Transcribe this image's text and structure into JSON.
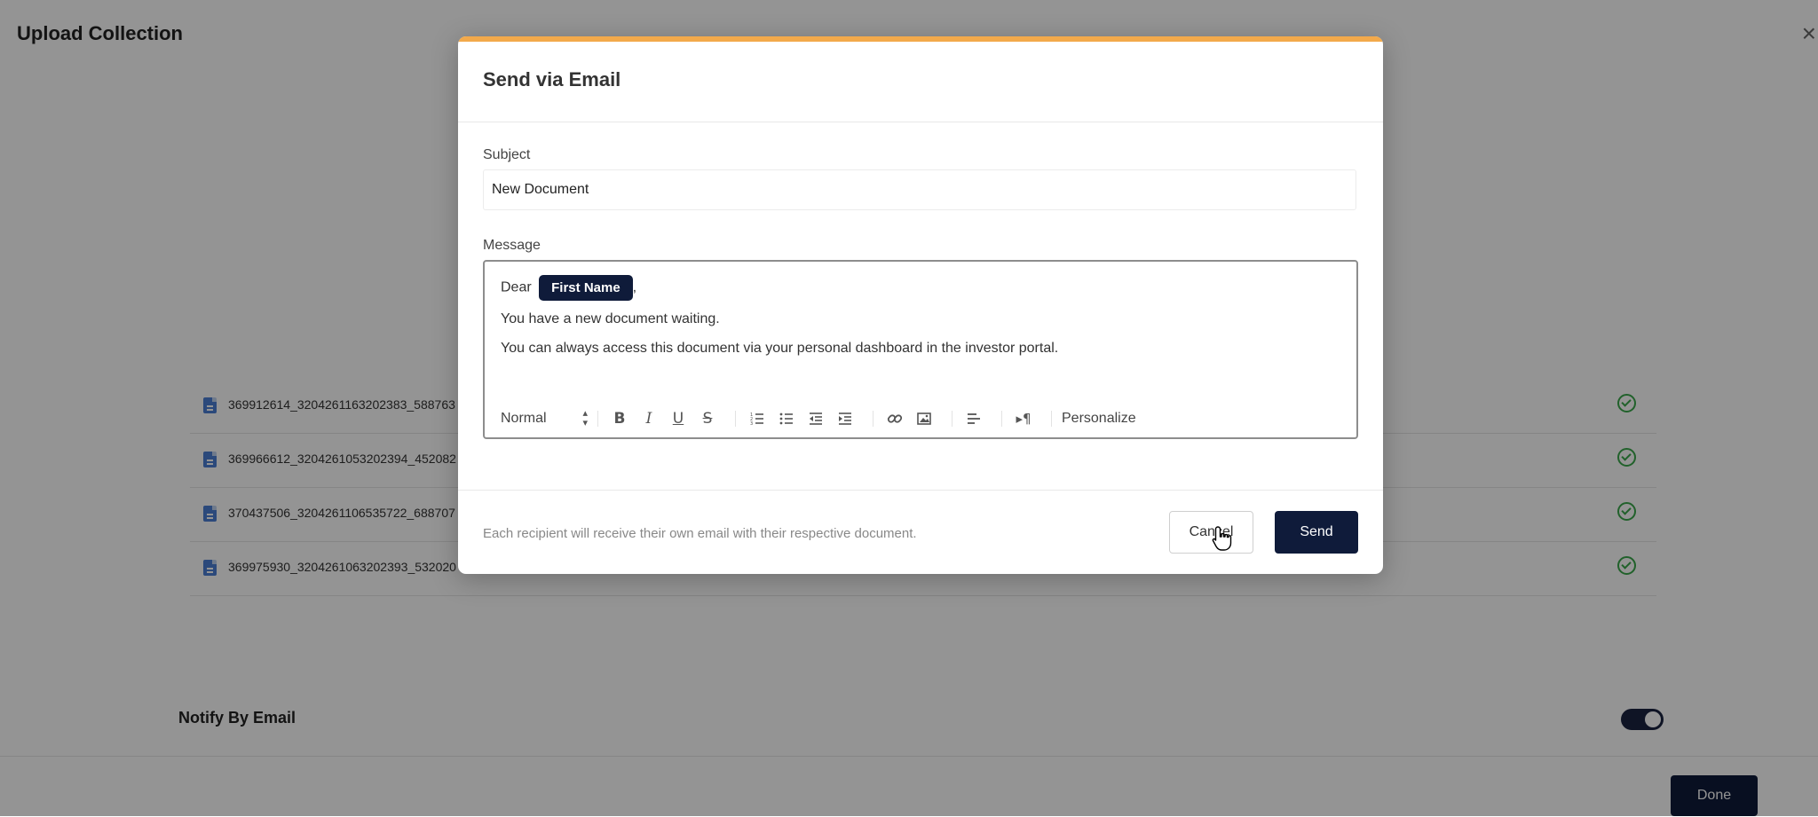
{
  "page": {
    "title": "Upload Collection",
    "close_icon": "close-icon",
    "files": [
      {
        "name": "369912614_3204261163202383_588763"
      },
      {
        "name": "369966612_3204261053202394_452082"
      },
      {
        "name": "370437506_3204261106535722_688707"
      },
      {
        "name": "369975930_3204261063202393_532020"
      }
    ],
    "notify_label": "Notify By Email",
    "notify_enabled": true,
    "done_label": "Done"
  },
  "modal": {
    "title": "Send via Email",
    "subject_label": "Subject",
    "subject_value": "New Document",
    "message_label": "Message",
    "message": {
      "greeting": "Dear",
      "tag": "First Name",
      "greeting_end": ",",
      "line1": "You have a new document waiting.",
      "line2": "You can always access this document via your personal dashboard in the investor portal."
    },
    "toolbar": {
      "format_select": "Normal",
      "buttons": [
        "bold-icon",
        "italic-icon",
        "underline-icon",
        "strikethrough-icon",
        "ordered-list-icon",
        "bullet-list-icon",
        "outdent-icon",
        "indent-icon",
        "link-icon",
        "image-icon",
        "align-icon",
        "text-direction-icon"
      ],
      "personalize_label": "Personalize"
    },
    "footer_note": "Each recipient will receive their own email with their respective document.",
    "cancel_label": "Cancel",
    "send_label": "Send"
  },
  "colors": {
    "accent": "#f2a94b",
    "primary": "#0f1b3a",
    "success": "#3aa84a"
  }
}
